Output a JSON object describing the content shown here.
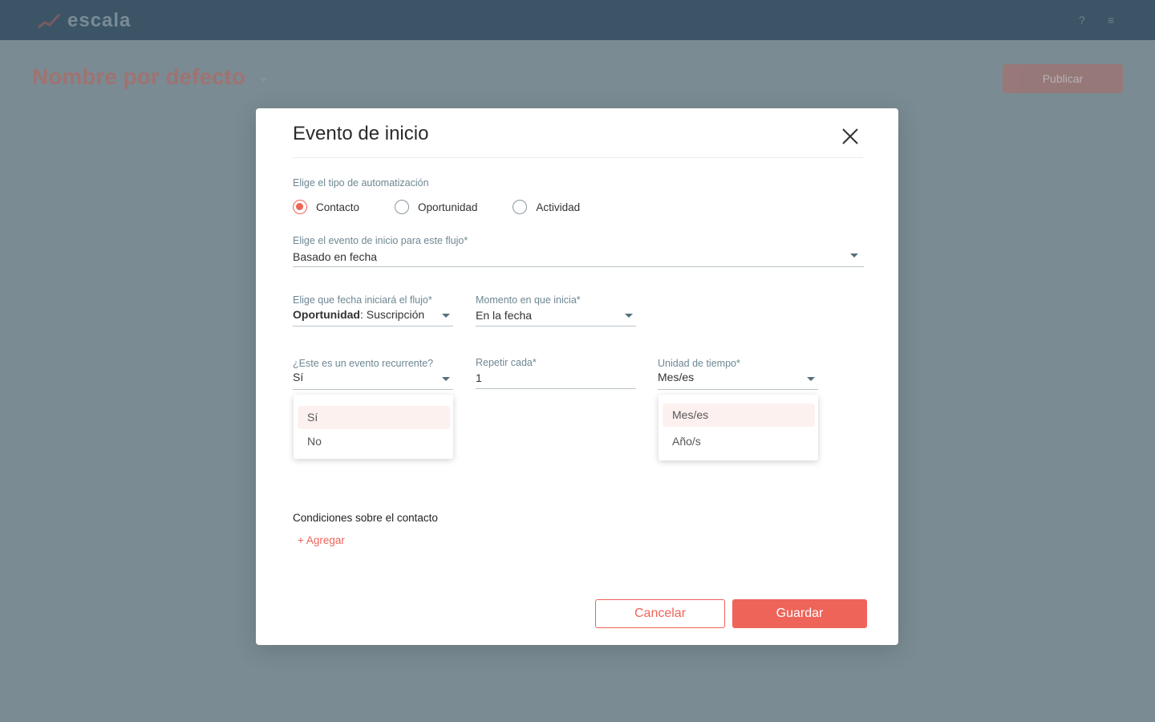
{
  "app": {
    "logo_text": "escala",
    "accent": "#ef6459",
    "header_bg": "#3c5566"
  },
  "background": {
    "page_title": "Nombre por defecto",
    "action_button": "Publicar"
  },
  "modal": {
    "title": "Evento de inicio",
    "automation_type": {
      "label": "Elige el tipo de automatización",
      "options": [
        {
          "label": "Contacto",
          "checked": true
        },
        {
          "label": "Oportunidad",
          "checked": false
        },
        {
          "label": "Actividad",
          "checked": false
        }
      ]
    },
    "start_event": {
      "label": "Elige el evento de inicio para este flujo*",
      "value": "Basado en fecha"
    },
    "start_date": {
      "label": "Elige que fecha iniciará el flujo*",
      "value_bold": "Oportunidad",
      "value_rest": ": Suscripción"
    },
    "start_moment": {
      "label": "Momento en que inicia*",
      "value": "En la fecha"
    },
    "recurrent": {
      "label": "¿Este es un evento recurrente?",
      "value": "Sí",
      "options": [
        "Sí",
        "No"
      ]
    },
    "repeat_every": {
      "label": "Repetir cada*",
      "value": "1"
    },
    "time_unit": {
      "label": "Unidad de tiempo*",
      "value": "Mes/es",
      "options": [
        "Mes/es",
        "Año/s"
      ]
    },
    "conditions": {
      "title": "Condiciones sobre el contacto",
      "add_label": "+ Agregar"
    },
    "buttons": {
      "cancel": "Cancelar",
      "save": "Guardar"
    }
  }
}
